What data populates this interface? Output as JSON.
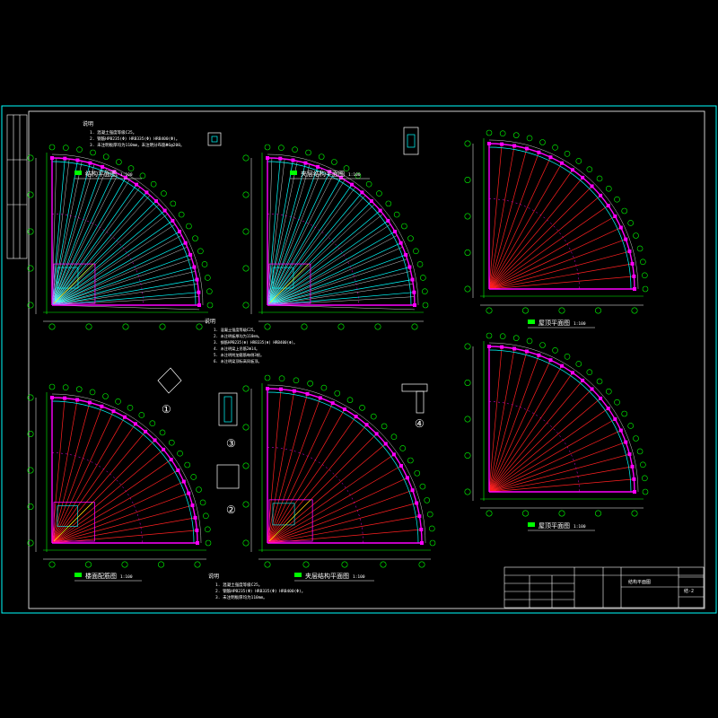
{
  "colors": {
    "background": "#000000",
    "frame": "#00ffff",
    "beam": "#00ffff",
    "arc": "#ff00ff",
    "radial": "#ff2020",
    "green": "#00ff00",
    "white": "#ffffff",
    "yellow": "#ffff00"
  },
  "views": [
    {
      "id": "top-left",
      "title": "结构平面图",
      "scale": "1:100",
      "style": "structure"
    },
    {
      "id": "top-middle",
      "title": "夹层结构平面图",
      "scale": "1:100",
      "style": "structure"
    },
    {
      "id": "top-right",
      "title": "屋顶平面图",
      "scale": "1:100",
      "style": "plan"
    },
    {
      "id": "bottom-left",
      "title": "楼面配筋图",
      "scale": "1:100",
      "style": "plan"
    },
    {
      "id": "bottom-middle",
      "title": "夹层结构平面图",
      "scale": "1:100",
      "style": "plan"
    },
    {
      "id": "bottom-right",
      "title": "屋顶平面图",
      "scale": "1:100",
      "style": "plan"
    }
  ],
  "notes": {
    "heading": "说明",
    "top_left": [
      "1. 混凝土强度等级C25。",
      "2. 钢筋HPB235(Φ) HRB335(Φ) HRB400(Φ)。",
      "3. 未注明板厚均为110mm，未注明分布筋Φ6@200。"
    ],
    "middle": [
      "1. 混凝土强度等级C25。",
      "2. 未注明板厚均为110mm。",
      "3. 钢筋HPB235(Φ) HRB335(Φ) HRB400(Φ)。",
      "4. 未注明梁上吊筋2Φ14。",
      "5. 未注明附加箍筋每侧3根。",
      "6. 未注明梁顶标高同板顶。"
    ],
    "bottom": [
      "1. 混凝土强度等级C25。",
      "2. 钢筋HPB235(Φ) HRB335(Φ) HRB400(Φ)。",
      "3. 未注明板厚均为110mm。"
    ]
  },
  "detail_labels": [
    "①",
    "②",
    "③",
    "④"
  ],
  "title_block": {
    "drawing_name": "结构平面图",
    "sheet_no": "结-2"
  }
}
